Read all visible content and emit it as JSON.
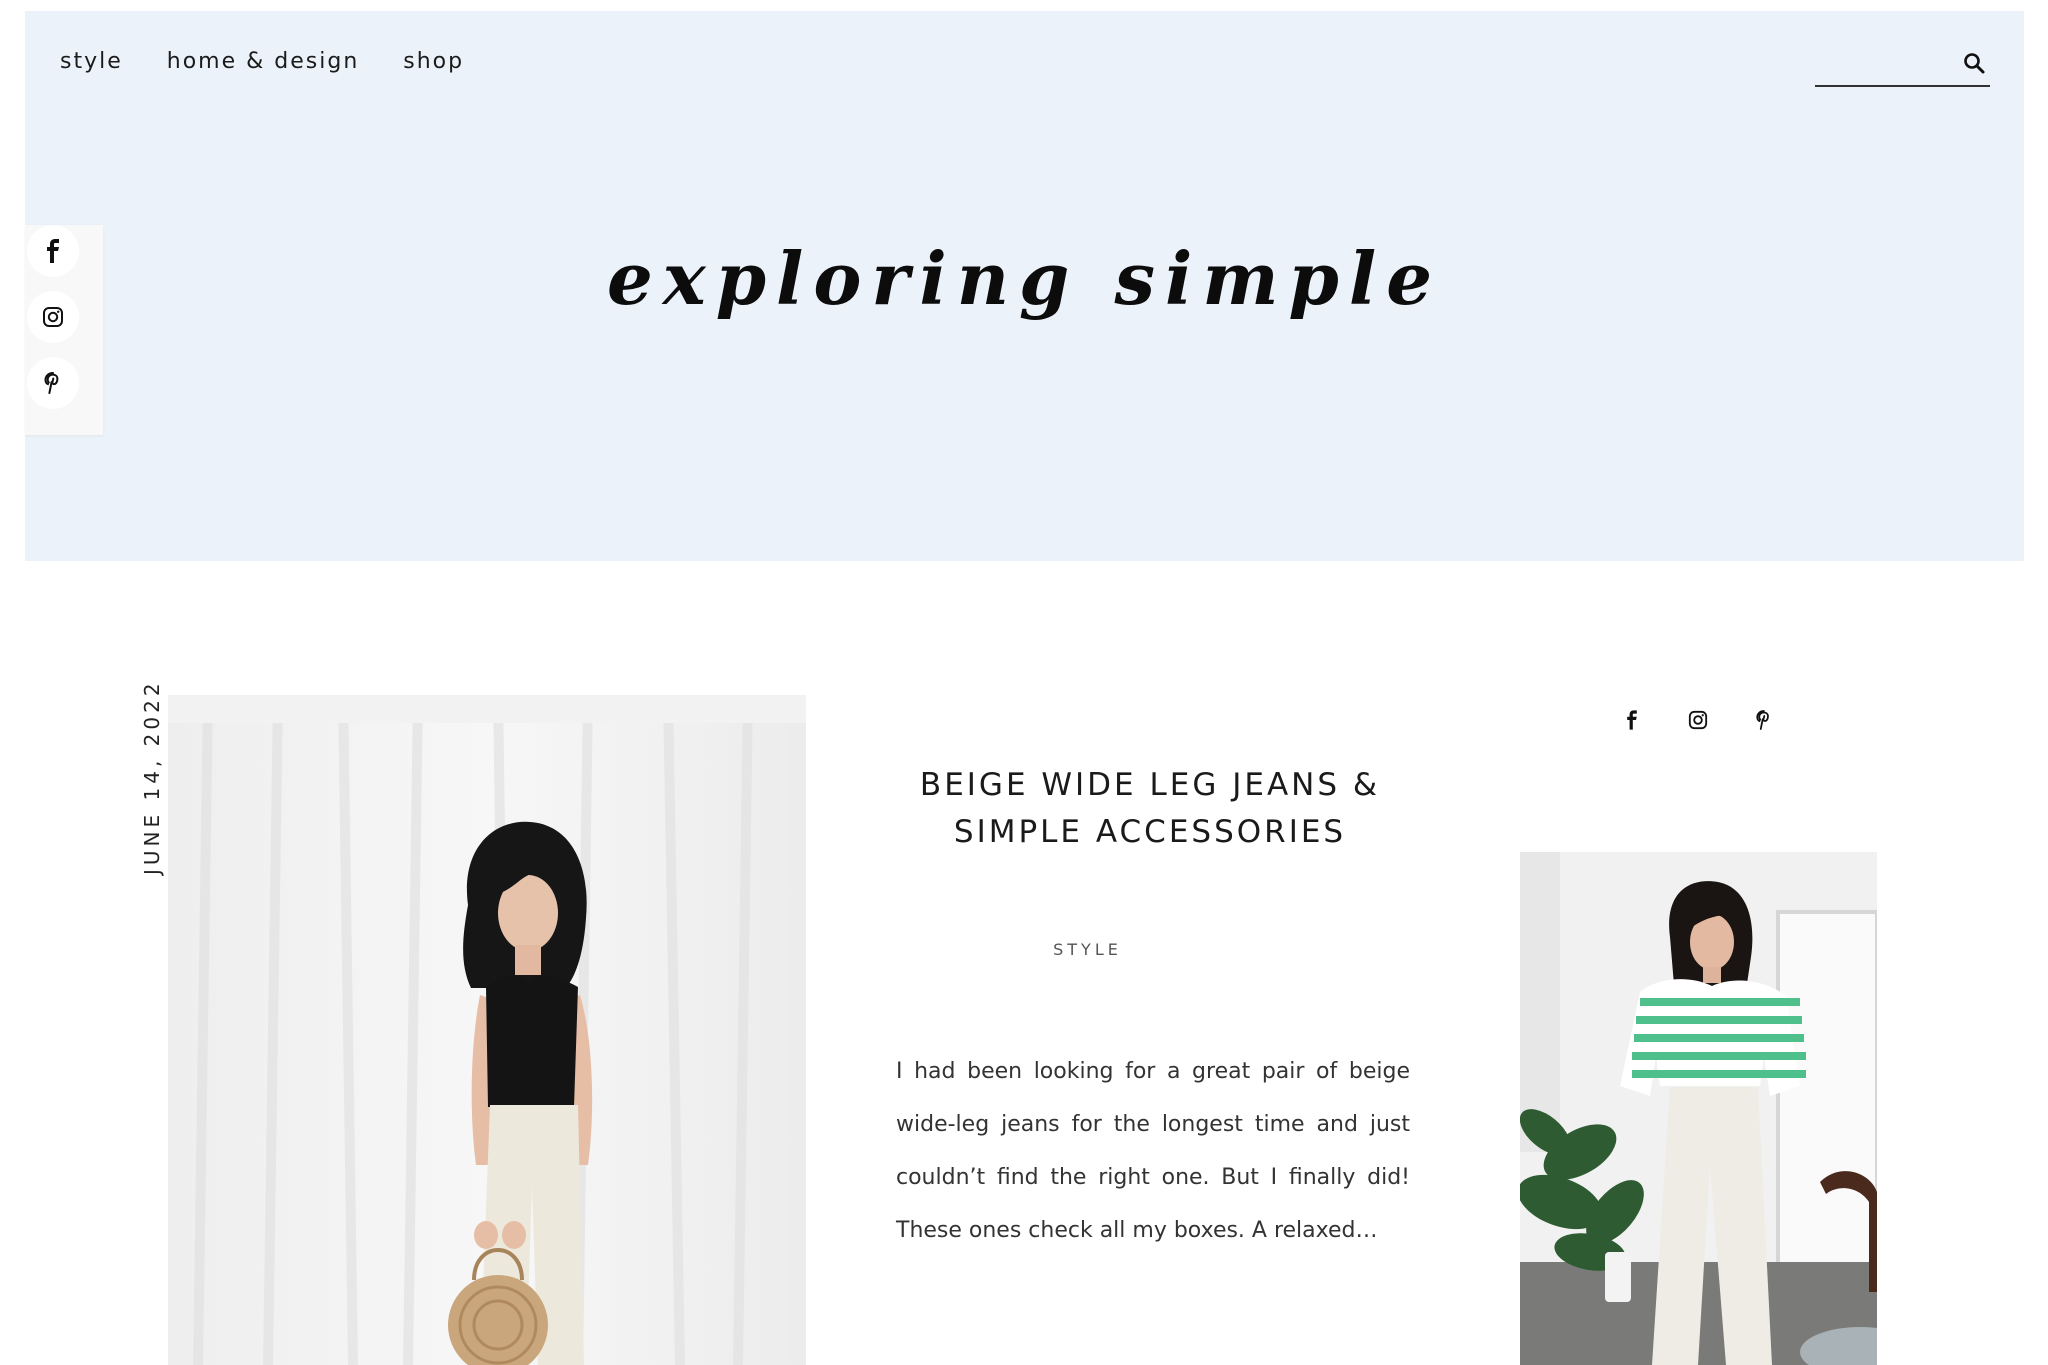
{
  "nav": {
    "items": [
      {
        "label": "style"
      },
      {
        "label": "home & design"
      },
      {
        "label": "shop"
      }
    ]
  },
  "search": {
    "value": "",
    "placeholder": "",
    "icon": "search-icon"
  },
  "brand": {
    "title": "exploring simple"
  },
  "social": {
    "icons": [
      "facebook-icon",
      "instagram-icon",
      "pinterest-icon"
    ]
  },
  "post": {
    "date": "JUNE 14, 2022",
    "title_line1": "BEIGE WIDE LEG JEANS &",
    "title_line2": "SIMPLE ACCESSORIES",
    "category": "STYLE",
    "excerpt": "I had been looking for a great pair of beige wide-leg jeans for the longest time and just couldn’t find the right one. But I finally did! These ones check all my boxes. A relaxed…"
  },
  "colors": {
    "header_bg": "#ecf2f9",
    "text": "#1b1b1b",
    "muted": "#555555"
  }
}
